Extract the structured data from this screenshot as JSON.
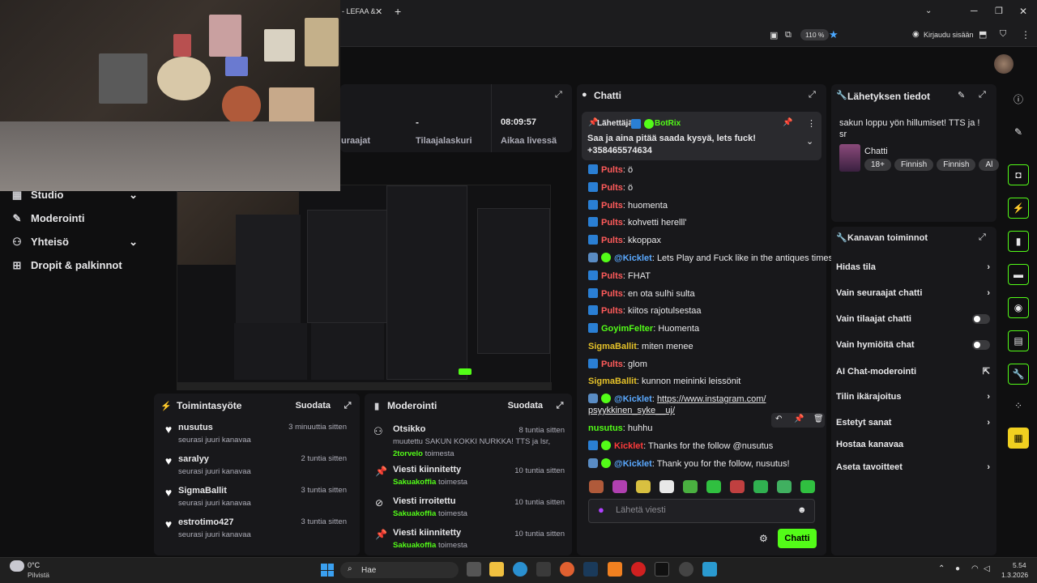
{
  "browser": {
    "tab_title": "- LEFAA &",
    "new_tab": "+",
    "zoom": "110 %",
    "sign_in": "Kirjaudu sisään"
  },
  "sidebar": {
    "items": [
      {
        "label": "Studio",
        "icon": "studio-icon",
        "chevron": true
      },
      {
        "label": "Moderointi",
        "icon": "sword-icon",
        "chevron": false
      },
      {
        "label": "Yhteisö",
        "icon": "community-icon",
        "chevron": true
      },
      {
        "label": "Dropit & palkinnot",
        "icon": "drops-icon",
        "chevron": false
      }
    ]
  },
  "stats": {
    "followers_label": "uraajat",
    "subs_value": "-",
    "subs_label": "Tilaajalaskuri",
    "uptime_value": "08:09:57",
    "uptime_label": "Aikaa livessä"
  },
  "activity": {
    "title": "Toimintasyöte",
    "filter": "Suodata",
    "items": [
      {
        "name": "nusutus",
        "sub": "seurasi juuri kanavaa",
        "time": "3 minuuttia sitten"
      },
      {
        "name": "saralyy",
        "sub": "seurasi juuri kanavaa",
        "time": "2 tuntia sitten"
      },
      {
        "name": "SigmaBallit",
        "sub": "seurasi juuri kanavaa",
        "time": "3 tuntia sitten"
      },
      {
        "name": "estrotimo427",
        "sub": "seurasi juuri kanavaa",
        "time": "3 tuntia sitten"
      }
    ]
  },
  "moderation": {
    "title": "Moderointi",
    "filter": "Suodata",
    "items": [
      {
        "name": "Otsikko",
        "detail": "muutettu SAKUN KOKKI NURKKA! TTS ja lsr,",
        "by": "2torvelo",
        "suffix": "toimesta",
        "time": "8 tuntia sitten",
        "icon": "people-icon"
      },
      {
        "name": "Viesti kiinnitetty",
        "by": "Sakuakoffia",
        "suffix": "toimesta",
        "time": "10 tuntia sitten",
        "icon": "pin-icon"
      },
      {
        "name": "Viesti irroitettu",
        "by": "Sakuakoffia",
        "suffix": "toimesta",
        "time": "10 tuntia sitten",
        "icon": "unpin-icon"
      },
      {
        "name": "Viesti kiinnitetty",
        "by": "Sakuakoffia",
        "suffix": "toimesta",
        "time": "10 tuntia sitten",
        "icon": "pin-icon"
      }
    ]
  },
  "chat": {
    "title": "Chatti",
    "pinned": {
      "label": "Lähettäjä",
      "sender": "BotRix",
      "text": "Saa ja aina pitää saada kysyä, lets fuck! +358465574634"
    },
    "messages": [
      {
        "user": "Pults",
        "color": "#ff5b5b",
        "text": "ö",
        "badges": [
          "kk"
        ]
      },
      {
        "user": "Pults",
        "color": "#ff5b5b",
        "text": "ö",
        "badges": [
          "kk"
        ]
      },
      {
        "user": "Pults",
        "color": "#ff5b5b",
        "text": "huomenta",
        "badges": [
          "kk"
        ]
      },
      {
        "user": "Pults",
        "color": "#ff5b5b",
        "text": "kohvetti herelll'",
        "badges": [
          "kk"
        ]
      },
      {
        "user": "Pults",
        "color": "#ff5b5b",
        "text": "kkoppax",
        "badges": [
          "kk"
        ]
      },
      {
        "user": "@Kicklet",
        "color": "#5aa9ff",
        "text": "Lets Play and Fuck like in the antiques times!",
        "badges": [
          "bot",
          "vb"
        ]
      },
      {
        "user": "Pults",
        "color": "#ff5b5b",
        "text": "FHAT",
        "badges": [
          "kk"
        ]
      },
      {
        "user": "Pults",
        "color": "#ff5b5b",
        "text": "en ota sulhi sulta",
        "badges": [
          "kk"
        ]
      },
      {
        "user": "Pults",
        "color": "#ff5b5b",
        "text": "kiitos rajotulsestaa",
        "badges": [
          "kk"
        ]
      },
      {
        "user": "GoyimFelter",
        "color": "#53fc18",
        "text": "Huomenta",
        "badges": [
          "gf"
        ]
      },
      {
        "user": "SigmaBallit",
        "color": "#e6c229",
        "text": "miten menee",
        "badges": []
      },
      {
        "user": "Pults",
        "color": "#ff5b5b",
        "text": "glom",
        "badges": [
          "kk"
        ]
      },
      {
        "user": "SigmaBallit",
        "color": "#e6c229",
        "text": "kunnon meininki leissönit",
        "badges": []
      },
      {
        "user": "@Kicklet",
        "color": "#5aa9ff",
        "text": "https://www.instagram.com/",
        "text2": "psyykkinen_syke__uj/",
        "badges": [
          "bot",
          "vb"
        ]
      },
      {
        "user": "nusutus",
        "color": "#53fc18",
        "text": "huhhu",
        "badges": []
      },
      {
        "user": "Kicklet",
        "color": "#ff3b3b",
        "text": "Thanks for the follow @nusutus",
        "badges": [
          "kk",
          "vb"
        ]
      },
      {
        "user": "@Kicklet",
        "color": "#5aa9ff",
        "text": "Thank you for the follow, nusutus!",
        "badges": [
          "bot",
          "vb"
        ]
      }
    ],
    "input_placeholder": "Lähetä viesti",
    "send_label": "Chatti"
  },
  "stream_info": {
    "title": "Lähetyksen tiedot",
    "stream_title": "sakun loppu yön hillumiset! TTS ja ! sr",
    "category": "Chatti",
    "tags": [
      "18+",
      "Finnish",
      "Finnish",
      "Al"
    ]
  },
  "channel_actions": {
    "title": "Kanavan toiminnot",
    "items": [
      {
        "label": "Hidas tila",
        "control": "chevron"
      },
      {
        "label": "Vain seuraajat chatti",
        "control": "chevron"
      },
      {
        "label": "Vain tilaajat chatti",
        "control": "toggle"
      },
      {
        "label": "Vain hymiöitä chat",
        "control": "toggle"
      },
      {
        "label": "AI Chat-moderointi",
        "control": "external"
      },
      {
        "label": "Tilin ikärajoitus",
        "control": "chevron"
      },
      {
        "label": "Estetyt sanat",
        "control": "chevron"
      },
      {
        "label": "Hostaa kanavaa",
        "control": "none"
      },
      {
        "label": "Aseta tavoitteet",
        "control": "chevron"
      }
    ]
  },
  "taskbar": {
    "weather_temp": "0°C",
    "weather_desc": "Pilvistä",
    "search": "Hae",
    "time": "5.54",
    "date": "1.3.2026"
  },
  "colors": {
    "accent": "#53fc18",
    "panel": "#18181b",
    "bg": "#0f0f10"
  }
}
